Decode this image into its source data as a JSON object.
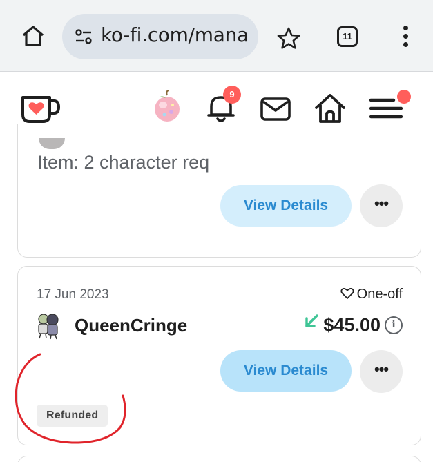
{
  "browser": {
    "url": "ko-fi.com/mana",
    "tab_count": "11"
  },
  "header": {
    "notification_count": "9"
  },
  "previous_item": {
    "item_text": "Item: 2 character req",
    "view_details_label": "View Details",
    "more_label": "•••"
  },
  "transaction": {
    "date": "17 Jun 2023",
    "type_label": "One-off",
    "supporter_name": "QueenCringe",
    "amount": "$45.00",
    "info_icon": "i",
    "view_details_label": "View Details",
    "more_label": "•••",
    "status_badge": "Refunded"
  },
  "colors": {
    "accent_blue": "#2a8ad0",
    "button_bg": "#d4eefc",
    "notification_red": "#ff5e5b",
    "incoming_green": "#3fc596",
    "annotation_red": "#e0242b"
  },
  "icons": [
    "home-icon",
    "tune-icon",
    "star-icon",
    "tabs-icon",
    "more-vert-icon",
    "kofi-cup-icon",
    "bell-icon",
    "mail-icon",
    "house-icon",
    "hamburger-icon",
    "heart-outline-icon",
    "incoming-arrow-icon",
    "info-icon"
  ]
}
